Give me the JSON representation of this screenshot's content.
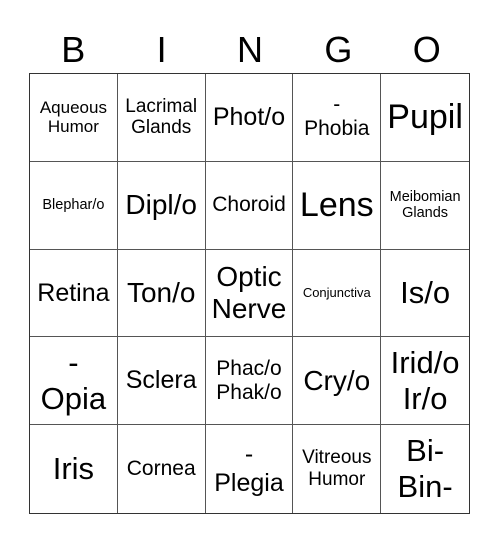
{
  "header": [
    "B",
    "I",
    "N",
    "G",
    "O"
  ],
  "cells": [
    {
      "text": "Aqueous\nHumor",
      "size": "s17"
    },
    {
      "text": "Lacrimal\nGlands",
      "size": "s19"
    },
    {
      "text": "Phot/o",
      "size": "s25"
    },
    {
      "text": "-\nPhobia",
      "size": "s21"
    },
    {
      "text": "Pupil",
      "size": "s34"
    },
    {
      "text": "Blephar/o",
      "size": "s14"
    },
    {
      "text": "Dipl/o",
      "size": "s28"
    },
    {
      "text": "Choroid",
      "size": "s21"
    },
    {
      "text": "Lens",
      "size": "s34"
    },
    {
      "text": "Meibomian\nGlands",
      "size": "s14"
    },
    {
      "text": "Retina",
      "size": "s25"
    },
    {
      "text": "Ton/o",
      "size": "s28"
    },
    {
      "text": "Optic\nNerve",
      "size": "s28"
    },
    {
      "text": "Conjunctiva",
      "size": "s13"
    },
    {
      "text": "Is/o",
      "size": "s31"
    },
    {
      "text": "-\nOpia",
      "size": "s31"
    },
    {
      "text": "Sclera",
      "size": "s25"
    },
    {
      "text": "Phac/o\nPhak/o",
      "size": "s21"
    },
    {
      "text": "Cry/o",
      "size": "s28"
    },
    {
      "text": "Irid/o\nIr/o",
      "size": "s31"
    },
    {
      "text": "Iris",
      "size": "s31"
    },
    {
      "text": "Cornea",
      "size": "s21"
    },
    {
      "text": "-\nPlegia",
      "size": "s25"
    },
    {
      "text": "Vitreous\nHumor",
      "size": "s19"
    },
    {
      "text": "Bi-\nBin-",
      "size": "s31"
    }
  ]
}
